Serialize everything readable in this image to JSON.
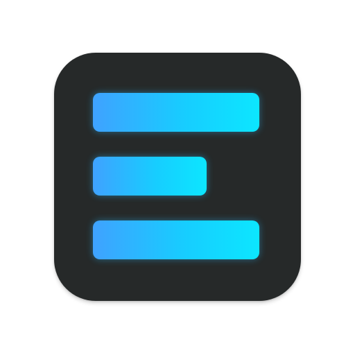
{
  "icon": {
    "name": "list-app-icon",
    "background_color": "#262929",
    "bar_gradient": [
      "#3fa2ff",
      "#0ce6ff"
    ],
    "bars": [
      {
        "id": "top",
        "length_fraction": 1.0
      },
      {
        "id": "middle",
        "length_fraction": 0.68
      },
      {
        "id": "bottom",
        "length_fraction": 1.0
      }
    ]
  }
}
